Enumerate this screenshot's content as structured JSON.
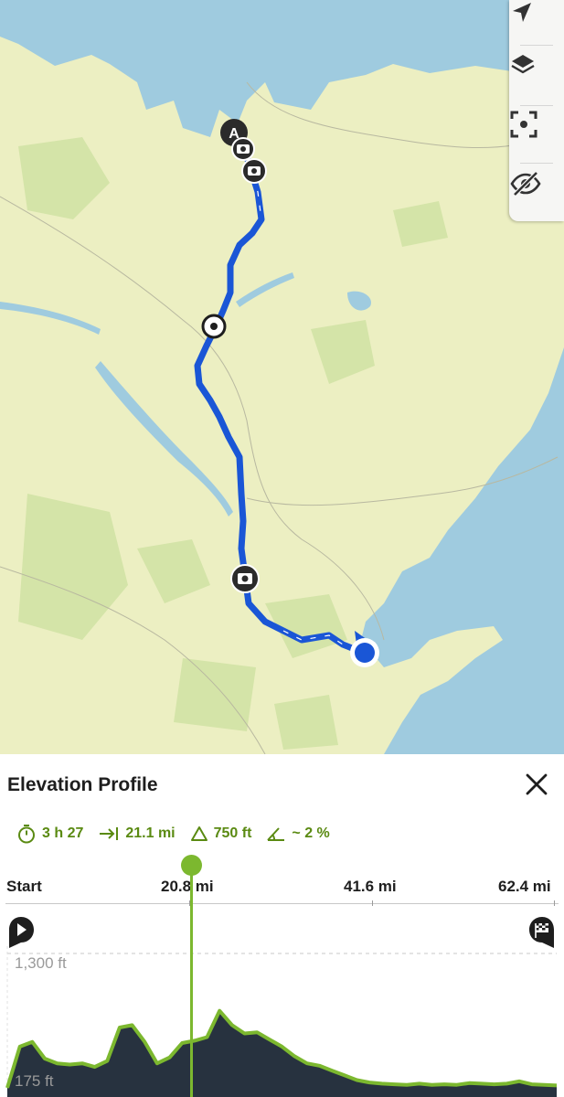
{
  "map": {
    "waypoints": [
      {
        "kind": "start",
        "label": "A"
      },
      {
        "kind": "photo"
      },
      {
        "kind": "photo"
      },
      {
        "kind": "poi"
      },
      {
        "kind": "photo"
      },
      {
        "kind": "current-location"
      }
    ],
    "colors": {
      "land": "#ecefc2",
      "water": "#9fcbdf",
      "forest": "#d4e4a8",
      "route": "#1a56d6"
    }
  },
  "toolbar": {
    "icons": [
      "navigate-arrow-icon",
      "layers-icon",
      "focus-route-icon",
      "hide-eye-icon"
    ]
  },
  "sheet": {
    "title": "Elevation Profile",
    "stats": {
      "duration": "3 h 27",
      "distance": "21.1 mi",
      "ascent": "750 ft",
      "grade": "~ 2 %"
    },
    "axis": {
      "start": "Start",
      "tick1": "20.8 mi",
      "tick2": "41.6 mi",
      "tick3": "62.4 mi"
    },
    "elevation": {
      "max_label": "1,300 ft",
      "min_label": "175 ft"
    },
    "colors": {
      "accent": "#7cb82f",
      "fill": "#27323f"
    }
  },
  "chart_data": {
    "type": "area",
    "x": [
      0,
      1.5,
      3,
      4.5,
      6,
      7.5,
      9,
      10.5,
      12,
      13.5,
      15,
      16.5,
      18,
      19.5,
      21,
      22.5,
      24,
      25.5,
      27,
      28.5,
      30,
      31.5,
      33,
      34.5,
      36,
      37.5,
      39,
      40.5,
      42,
      43.5,
      45,
      46.5,
      48,
      49.5,
      51,
      52.5,
      54,
      55.5,
      57,
      58.5,
      60,
      61.5,
      63,
      64.5,
      66
    ],
    "values": [
      175,
      520,
      560,
      420,
      380,
      370,
      380,
      350,
      400,
      680,
      700,
      560,
      380,
      430,
      550,
      570,
      600,
      820,
      700,
      630,
      640,
      580,
      520,
      440,
      380,
      360,
      320,
      280,
      240,
      220,
      210,
      205,
      200,
      210,
      200,
      205,
      200,
      215,
      210,
      205,
      210,
      230,
      205,
      200,
      195
    ],
    "ylim": [
      175,
      1300
    ],
    "xlabel": "",
    "ylabel": "",
    "cursor_x": 20.8
  }
}
